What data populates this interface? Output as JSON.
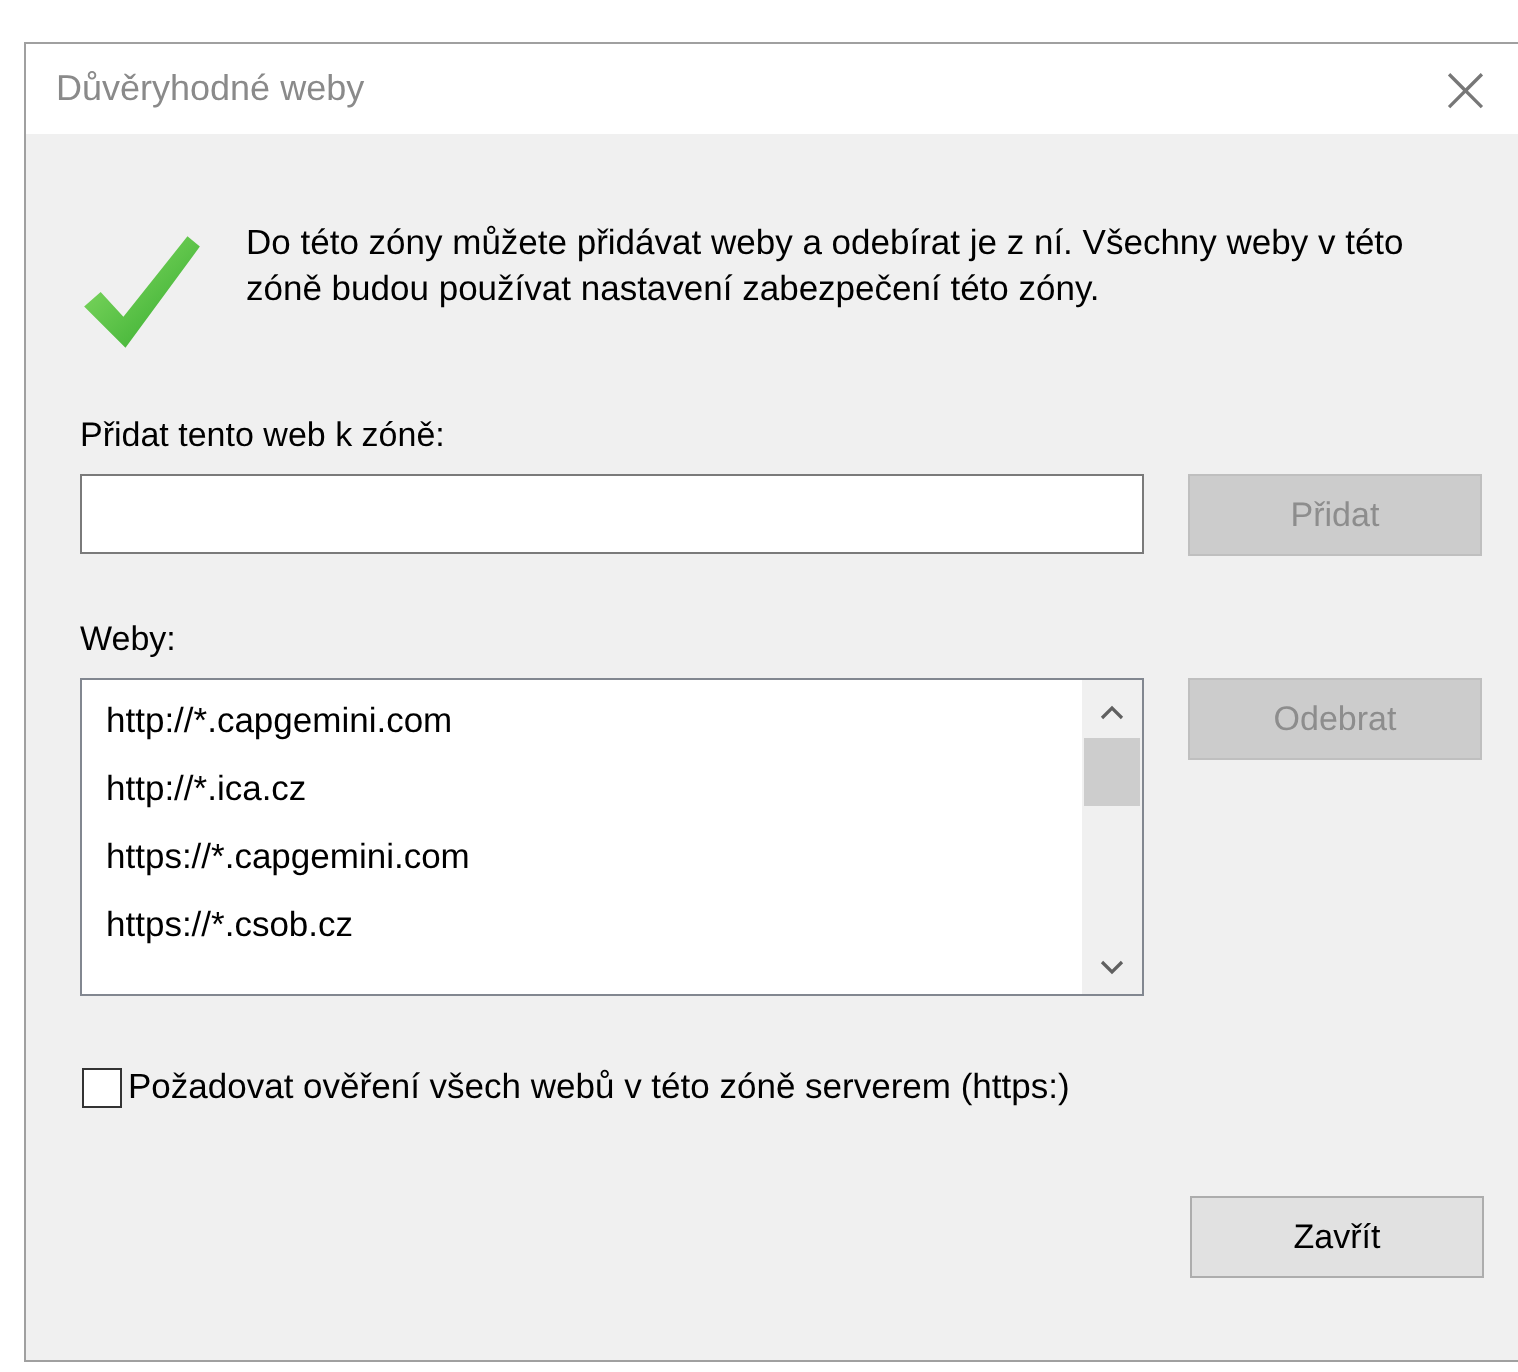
{
  "window": {
    "title": "Důvěryhodné weby",
    "close": "×"
  },
  "info": {
    "text": "Do této zóny můžete přidávat weby a odebírat je z ní. Všechny weby v této zóně budou používat nastavení zabezpečení této zóny."
  },
  "add": {
    "label": "Přidat tento web k zóně:",
    "button": {
      "label": "Přidat",
      "disabled": true
    }
  },
  "sites": {
    "label": "Weby:",
    "items": [
      {
        "text": "http://*.capgemini.com",
        "selected": false
      },
      {
        "text": "http://*.ica.cz",
        "selected": false
      },
      {
        "text": "https://*.capgemini.com",
        "selected": false
      },
      {
        "text": "https://*.csob.cz",
        "selected": false
      }
    ],
    "button": {
      "label": "Odebrat",
      "disabled": true
    }
  },
  "require_https": {
    "label": "Požadovat ověření všech webů v této zóně serverem (https:)",
    "checked": false
  },
  "buttons": [
    {
      "label": "Zavřít",
      "disabled": false
    }
  ]
}
